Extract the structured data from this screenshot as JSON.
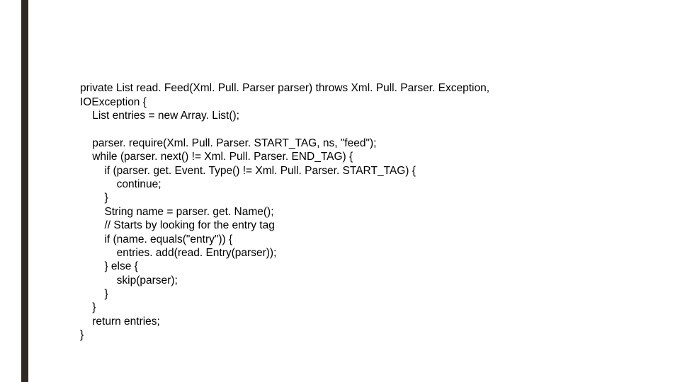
{
  "code": {
    "l01": "private List read. Feed(Xml. Pull. Parser parser) throws Xml. Pull. Parser. Exception,",
    "l02": "IOException {",
    "l03": "    List entries = new Array. List();",
    "l04": "",
    "l05": "    parser. require(Xml. Pull. Parser. START_TAG, ns, \"feed\");",
    "l06": "    while (parser. next() != Xml. Pull. Parser. END_TAG) {",
    "l07": "        if (parser. get. Event. Type() != Xml. Pull. Parser. START_TAG) {",
    "l08": "            continue;",
    "l09": "        }",
    "l10": "        String name = parser. get. Name();",
    "l11": "        // Starts by looking for the entry tag",
    "l12": "        if (name. equals(\"entry\")) {",
    "l13": "            entries. add(read. Entry(parser));",
    "l14": "        } else {",
    "l15": "            skip(parser);",
    "l16": "        }",
    "l17": "    }",
    "l18": "    return entries;",
    "l19": "}"
  }
}
